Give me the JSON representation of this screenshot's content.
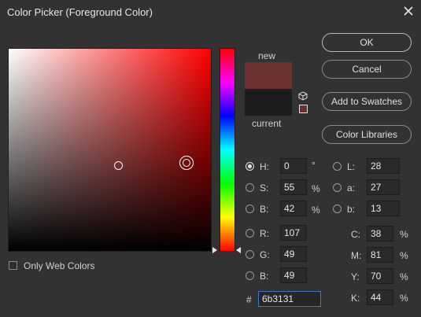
{
  "window": {
    "title": "Color Picker (Foreground Color)"
  },
  "colors": {
    "field_hue": "#ff0000",
    "new_swatch": "#6b3131",
    "current_swatch": "#1c1c1c",
    "accent_input_border": "#3c76c8"
  },
  "swatches": {
    "new_label": "new",
    "current_label": "current"
  },
  "buttons": {
    "ok": "OK",
    "cancel": "Cancel",
    "add_to_swatches": "Add to Swatches",
    "color_libraries": "Color Libraries"
  },
  "hsb": [
    {
      "label": "H:",
      "value": "0",
      "unit": "°",
      "selected": true
    },
    {
      "label": "S:",
      "value": "55",
      "unit": "%",
      "selected": false
    },
    {
      "label": "B:",
      "value": "42",
      "unit": "%",
      "selected": false
    }
  ],
  "rgb": [
    {
      "label": "R:",
      "value": "107"
    },
    {
      "label": "G:",
      "value": "49"
    },
    {
      "label": "B:",
      "value": "49"
    }
  ],
  "lab": [
    {
      "label": "L:",
      "value": "28"
    },
    {
      "label": "a:",
      "value": "27"
    },
    {
      "label": "b:",
      "value": "13"
    }
  ],
  "cmyk": [
    {
      "label": "C:",
      "value": "38",
      "unit": "%"
    },
    {
      "label": "M:",
      "value": "81",
      "unit": "%"
    },
    {
      "label": "Y:",
      "value": "70",
      "unit": "%"
    },
    {
      "label": "K:",
      "value": "44",
      "unit": "%"
    }
  ],
  "hex": {
    "prefix": "#",
    "value": "6b3131"
  },
  "only_web_colors": {
    "label": "Only Web Colors",
    "checked": false
  },
  "icons": {
    "close": "close-icon",
    "gamut_cube": "cube-icon",
    "web_safe_swatch": "web-safe-swatch-icon"
  }
}
